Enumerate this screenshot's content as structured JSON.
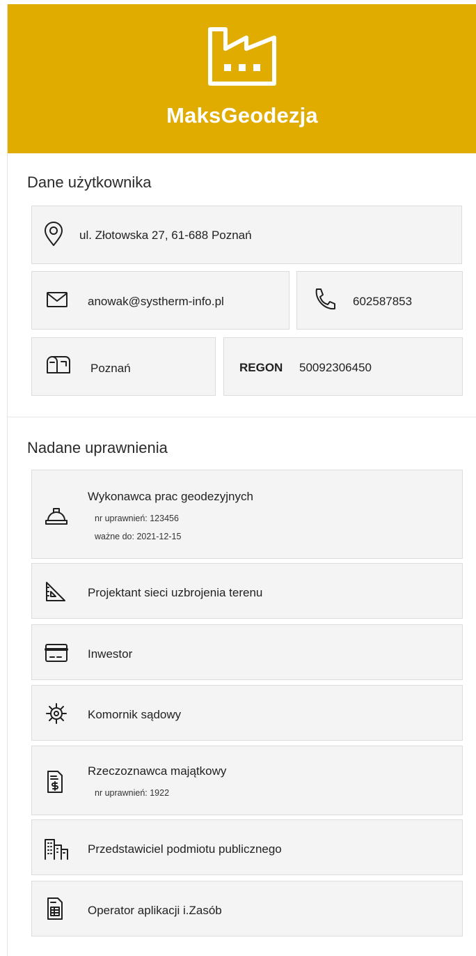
{
  "header": {
    "brand": "MaksGeodezja",
    "logo_icon": "factory-icon",
    "color": "#e0ac00"
  },
  "user_section": {
    "title": "Dane użytkownika",
    "address": "ul. Złotowska 27, 61-688 Poznań",
    "email": "anowak@systherm-info.pl",
    "phone": "602587853",
    "city": "Poznań",
    "regon_label": "REGON",
    "regon_value": "50092306450"
  },
  "permissions_section": {
    "title": "Nadane uprawnienia",
    "items": [
      {
        "label": "Wykonawca prac geodezyjnych",
        "details": [
          "nr uprawnień: 123456",
          "ważne do: 2021-12-15"
        ],
        "icon": "hard-hat-icon"
      },
      {
        "label": "Projektant sieci uzbrojenia terenu",
        "icon": "set-square-icon"
      },
      {
        "label": "Inwestor",
        "icon": "credit-card-icon"
      },
      {
        "label": "Komornik sądowy",
        "icon": "gear-icon"
      },
      {
        "label": "Rzeczoznawca majątkowy",
        "details": [
          "nr uprawnień: 1922"
        ],
        "icon": "dollar-document-icon"
      },
      {
        "label": "Przedstawiciel podmiotu publicznego",
        "icon": "buildings-icon"
      },
      {
        "label": "Operator aplikacji i.Zasób",
        "icon": "spreadsheet-document-icon"
      }
    ]
  }
}
